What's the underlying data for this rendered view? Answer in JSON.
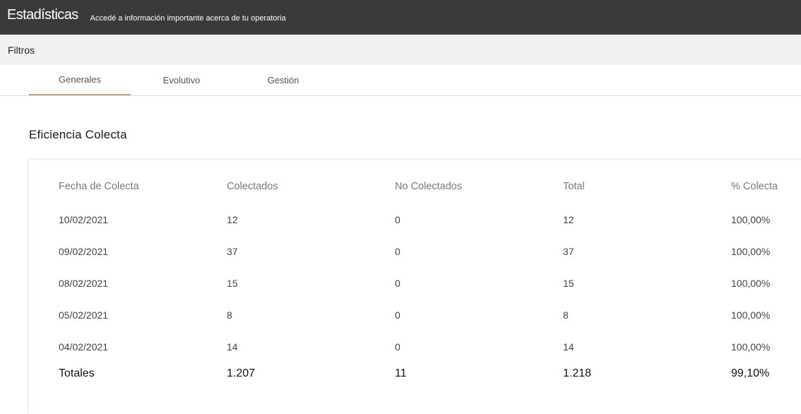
{
  "header": {
    "title": "Estadísticas",
    "subtitle": "Accedé a información importante acerca de tu operatoria"
  },
  "filters": {
    "label": "Filtros"
  },
  "tabs": [
    {
      "label": "Generales",
      "active": true
    },
    {
      "label": "Evolutivo",
      "active": false
    },
    {
      "label": "Gestión",
      "active": false
    }
  ],
  "section": {
    "title": "Eficiencia Colecta"
  },
  "table": {
    "columns": [
      "Fecha de Colecta",
      "Colectados",
      "No Colectados",
      "Total",
      "% Colecta"
    ],
    "rows": [
      [
        "10/02/2021",
        "12",
        "0",
        "12",
        "100,00%"
      ],
      [
        "09/02/2021",
        "37",
        "0",
        "37",
        "100,00%"
      ],
      [
        "08/02/2021",
        "15",
        "0",
        "15",
        "100,00%"
      ],
      [
        "05/02/2021",
        "8",
        "0",
        "8",
        "100,00%"
      ],
      [
        "04/02/2021",
        "14",
        "0",
        "14",
        "100,00%"
      ]
    ],
    "totals": [
      "Totales",
      "1.207",
      "11",
      "1.218",
      "99,10%"
    ]
  },
  "colors": {
    "topbar": "#3a3a3a",
    "filters_bg": "#f1f1f1",
    "tab_accent": "#c9a07c"
  }
}
